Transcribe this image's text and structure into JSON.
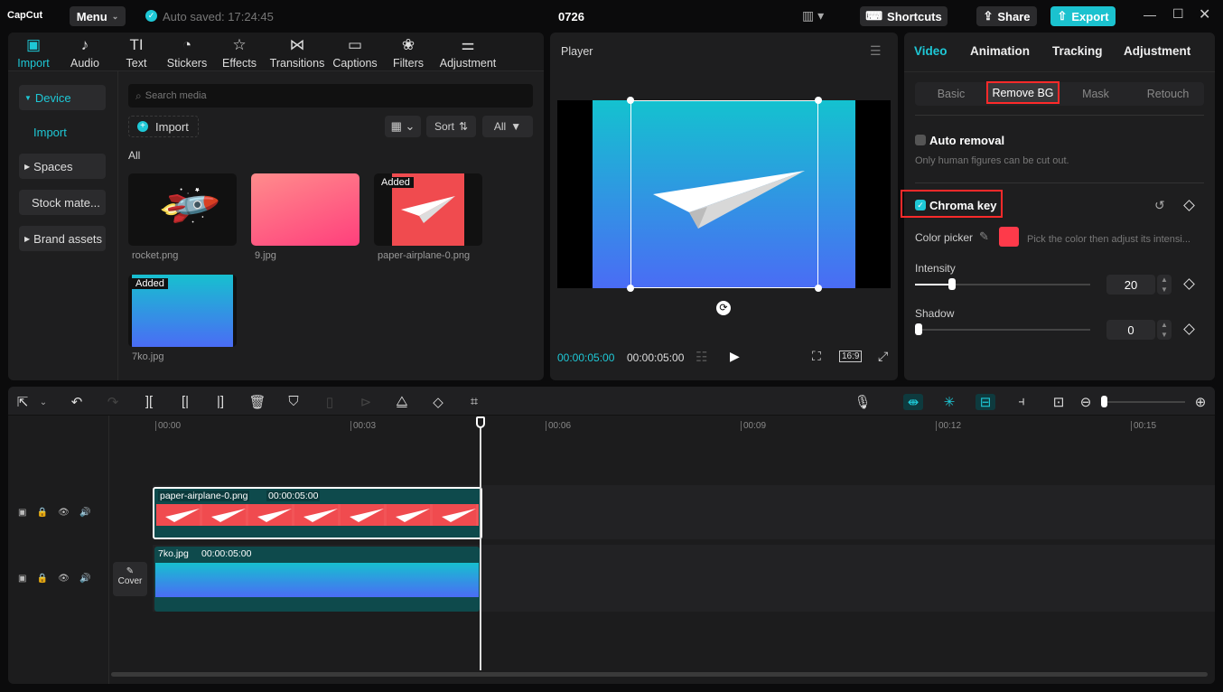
{
  "app": {
    "logo": "CapCut",
    "menu": "Menu",
    "autosave": "Auto saved: 17:24:45",
    "project_title": "0726",
    "shortcuts": "Shortcuts",
    "share": "Share",
    "export": "Export"
  },
  "colors": {
    "accent": "#1ec8d6",
    "highlight_box": "#ff2a2a",
    "picked_color": "#fe3a4a",
    "export_bg": "#1bc2cf"
  },
  "media_tabs": [
    {
      "label": "Import",
      "icon": "import-icon",
      "active": true
    },
    {
      "label": "Audio",
      "icon": "audio-icon"
    },
    {
      "label": "Text",
      "icon": "text-icon"
    },
    {
      "label": "Stickers",
      "icon": "stickers-icon"
    },
    {
      "label": "Effects",
      "icon": "effects-icon"
    },
    {
      "label": "Transitions",
      "icon": "transitions-icon"
    },
    {
      "label": "Captions",
      "icon": "captions-icon"
    },
    {
      "label": "Filters",
      "icon": "filters-icon"
    },
    {
      "label": "Adjustment",
      "icon": "adjustment-icon"
    }
  ],
  "sidebar": {
    "device": "Device",
    "import": "Import",
    "spaces": "Spaces",
    "stock": "Stock mate...",
    "brand": "Brand assets"
  },
  "media": {
    "search_placeholder": "Search media",
    "import": "Import",
    "sort": "Sort",
    "filter": "All",
    "section": "All",
    "items": [
      {
        "name": "rocket.png",
        "added": ""
      },
      {
        "name": "9.jpg",
        "added": ""
      },
      {
        "name": "paper-airplane-0.png",
        "added": "Added"
      },
      {
        "name": "7ko.jpg",
        "added": "Added"
      }
    ]
  },
  "player": {
    "title": "Player",
    "current_time": "00:00:05:00",
    "total_time": "00:00:05:00",
    "ratio": "16:9"
  },
  "right": {
    "tabs": [
      "Video",
      "Animation",
      "Tracking",
      "Adjustment"
    ],
    "subtabs": [
      "Basic",
      "Remove BG",
      "Mask",
      "Retouch"
    ],
    "auto_removal": "Auto removal",
    "auto_hint": "Only human figures can be cut out.",
    "auto_checked": false,
    "chroma_key": "Chroma key",
    "chroma_checked": true,
    "color_picker": "Color picker",
    "picker_hint": "Pick the color then adjust its intensi...",
    "intensity_label": "Intensity",
    "intensity": "20",
    "shadow_label": "Shadow",
    "shadow": "0"
  },
  "timeline": {
    "ticks": [
      "00:00",
      "00:03",
      "00:06",
      "00:09",
      "00:12",
      "00:15"
    ],
    "clips": [
      {
        "name": "paper-airplane-0.png",
        "duration": "00:00:05:00"
      },
      {
        "name": "7ko.jpg",
        "duration": "00:00:05:00"
      }
    ],
    "cover": "Cover"
  }
}
